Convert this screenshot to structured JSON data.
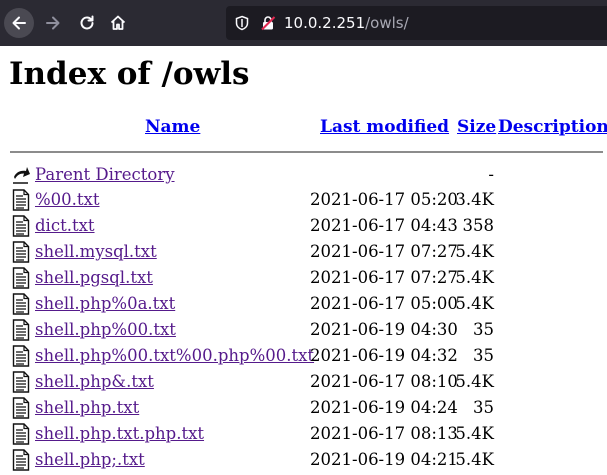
{
  "browser": {
    "url_host": "10.0.2.251",
    "url_path": "/owls/"
  },
  "page": {
    "title": "Index of /owls",
    "columns": {
      "name": "Name",
      "last_modified": "Last modified",
      "size": "Size",
      "description": "Description"
    },
    "parent": {
      "name": "Parent Directory",
      "size": "-",
      "icon": "back-arrow-icon"
    },
    "rows": [
      {
        "name": "%00.txt",
        "modified": "2021-06-17 05:20",
        "size": "3.4K",
        "icon": "text-file-icon"
      },
      {
        "name": "dict.txt",
        "modified": "2021-06-17 04:43",
        "size": "358",
        "icon": "text-file-icon"
      },
      {
        "name": "shell.mysql.txt",
        "modified": "2021-06-17 07:27",
        "size": "5.4K",
        "icon": "text-file-icon"
      },
      {
        "name": "shell.pgsql.txt",
        "modified": "2021-06-17 07:27",
        "size": "5.4K",
        "icon": "text-file-icon"
      },
      {
        "name": "shell.php%0a.txt",
        "modified": "2021-06-17 05:00",
        "size": "5.4K",
        "icon": "text-file-icon"
      },
      {
        "name": "shell.php%00.txt",
        "modified": "2021-06-19 04:30",
        "size": "35",
        "icon": "text-file-icon"
      },
      {
        "name": "shell.php%00.txt%00.php%00.txt",
        "modified": "2021-06-19 04:32",
        "size": "35",
        "icon": "text-file-icon"
      },
      {
        "name": "shell.php&.txt",
        "modified": "2021-06-17 08:10",
        "size": "5.4K",
        "icon": "text-file-icon"
      },
      {
        "name": "shell.php.txt",
        "modified": "2021-06-19 04:24",
        "size": "35",
        "icon": "text-file-icon"
      },
      {
        "name": "shell.php.txt.php.txt",
        "modified": "2021-06-17 08:13",
        "size": "5.4K",
        "icon": "text-file-icon"
      },
      {
        "name": "shell.php;.txt",
        "modified": "2021-06-19 04:21",
        "size": "5.4K",
        "icon": "text-file-icon"
      }
    ]
  }
}
